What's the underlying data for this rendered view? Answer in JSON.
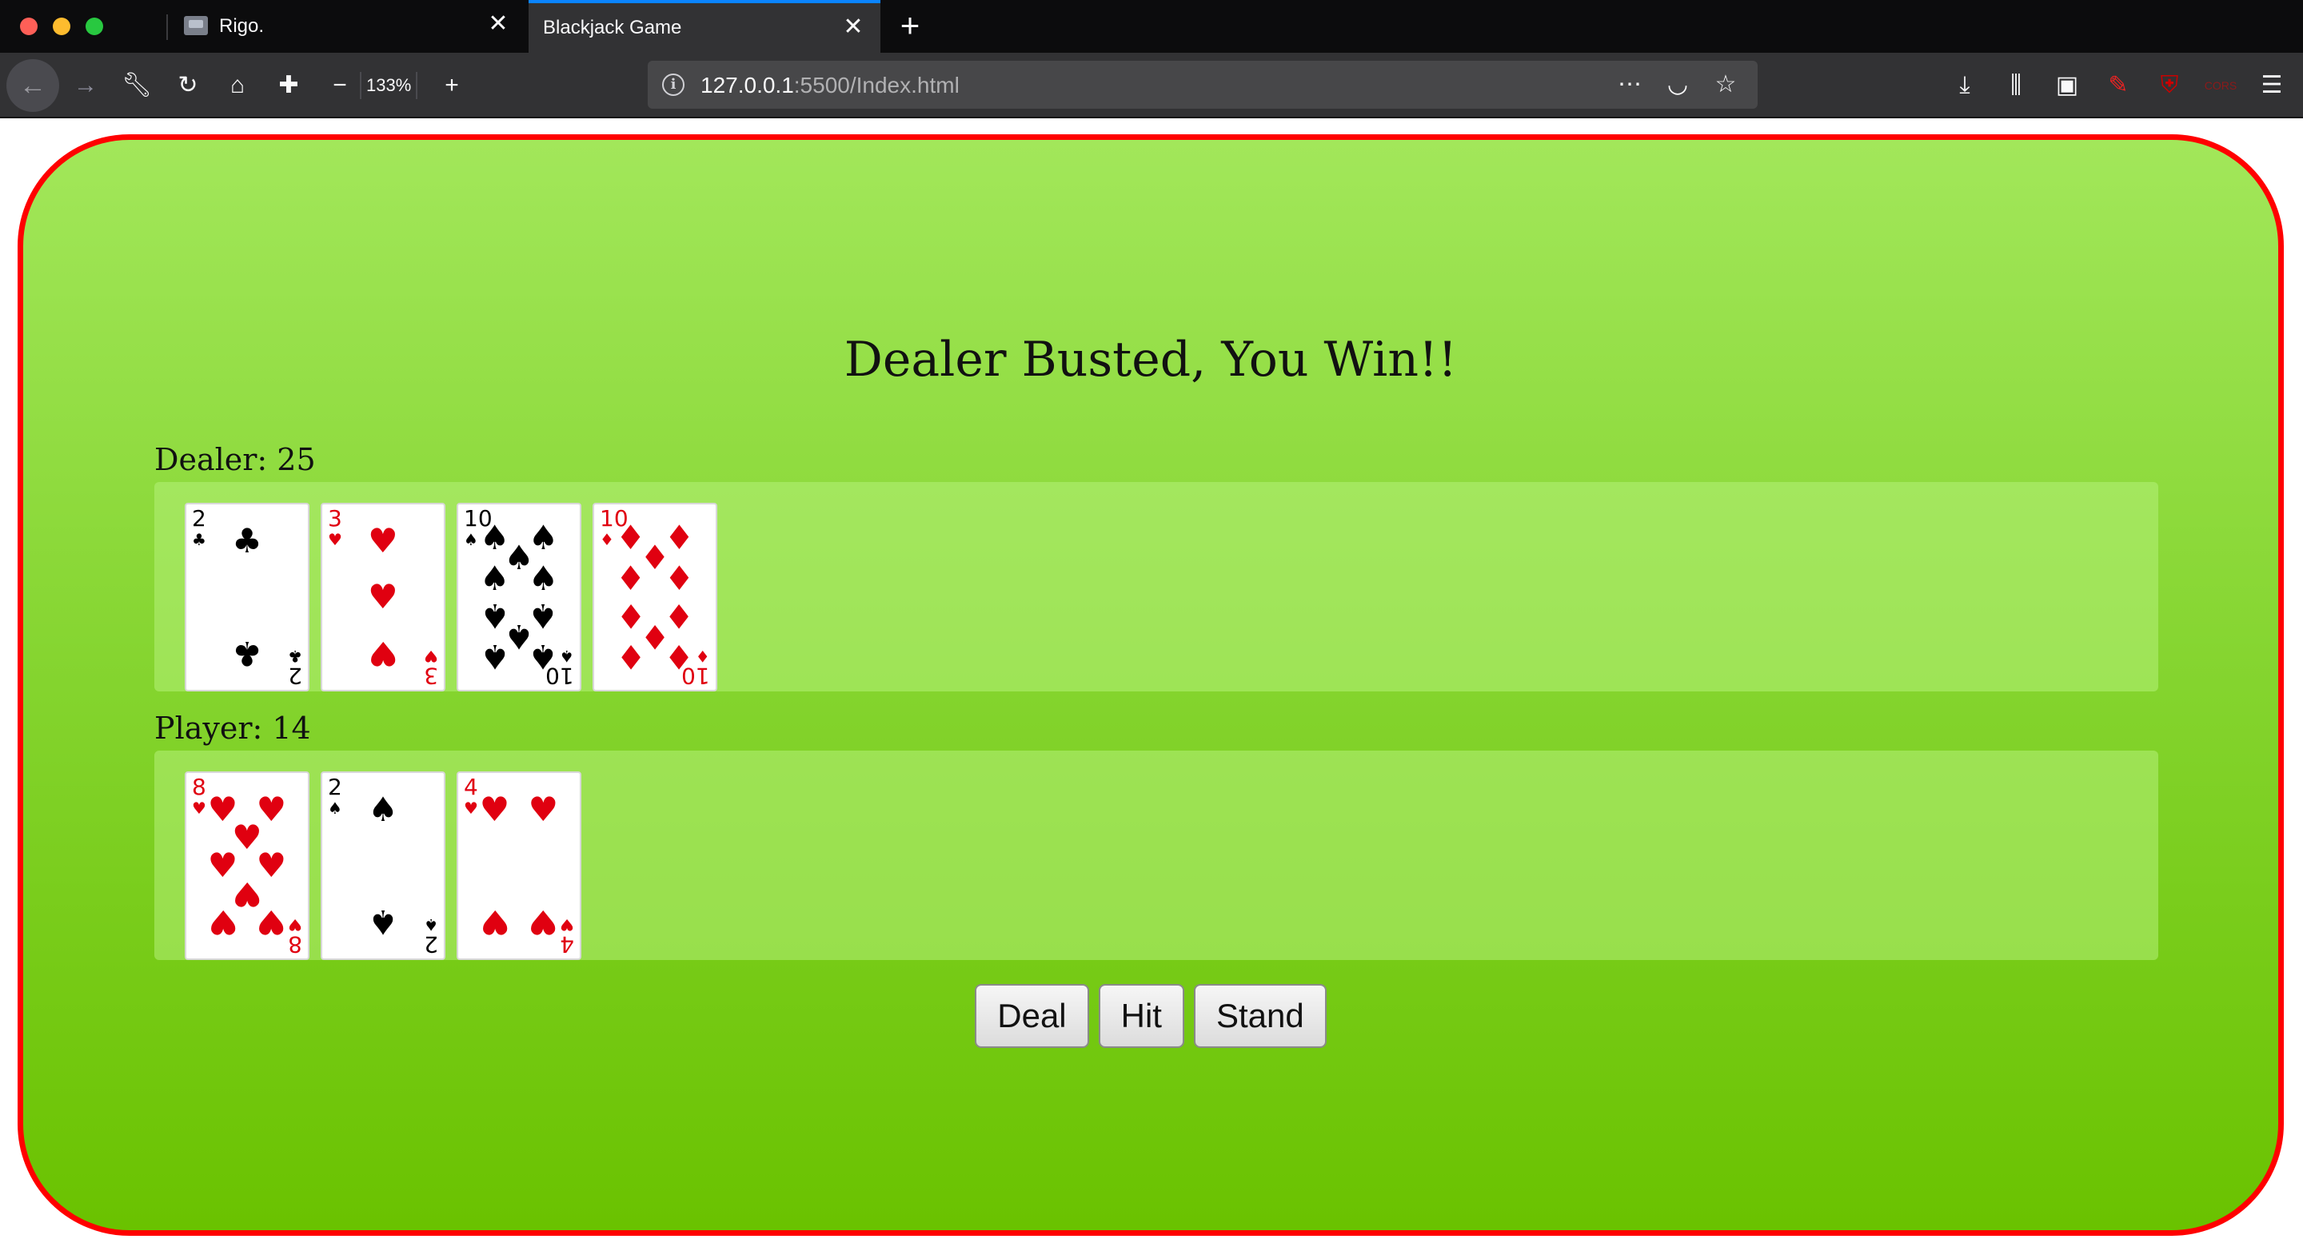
{
  "browser": {
    "tabs": [
      {
        "title": "Rigo.",
        "active": false
      },
      {
        "title": "Blackjack Game",
        "active": true
      }
    ],
    "zoom": "133%",
    "url_host": "127.0.0.1",
    "url_rest": ":5500/Index.html"
  },
  "game": {
    "status": "Dealer Busted, You Win!!",
    "dealer_label": "Dealer: 25",
    "player_label": "Player: 14",
    "dealer_cards": [
      {
        "rank": "2",
        "suit": "clubs"
      },
      {
        "rank": "3",
        "suit": "hearts"
      },
      {
        "rank": "10",
        "suit": "spades"
      },
      {
        "rank": "10",
        "suit": "diamonds"
      }
    ],
    "player_cards": [
      {
        "rank": "8",
        "suit": "hearts"
      },
      {
        "rank": "2",
        "suit": "spades"
      },
      {
        "rank": "4",
        "suit": "hearts"
      }
    ],
    "buttons": {
      "deal": "Deal",
      "hit": "Hit",
      "stand": "Stand"
    }
  },
  "colors": {
    "table_border": "#ff0000",
    "table_top": "#a2e75a",
    "table_bottom": "#6ac200",
    "red_suit": "#e00010"
  }
}
